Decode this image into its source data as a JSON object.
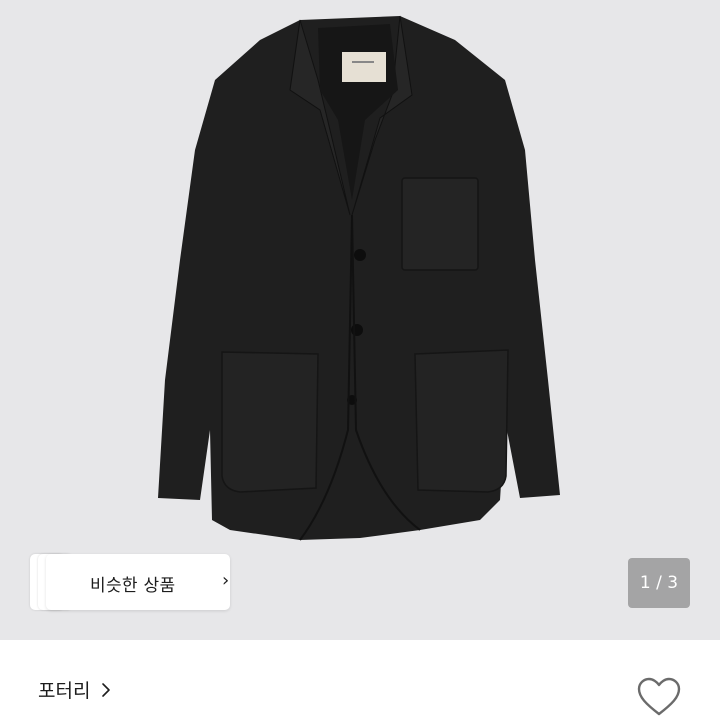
{
  "product": {
    "image_icon": "jacket-photo",
    "similar_button": {
      "label": "비슷한 상품",
      "chevron": "›"
    },
    "pager": {
      "current": 1,
      "total": 3,
      "label": "1 / 3"
    }
  },
  "seller": {
    "brand": "포터리",
    "chevron_icon": "chevron-right-icon",
    "like_icon": "heart-outline-icon"
  },
  "colors": {
    "photo_background": "#e7e7e9",
    "garment": "#202020",
    "text": "#1d1d1d",
    "pager_background": "#8a8a8a"
  }
}
